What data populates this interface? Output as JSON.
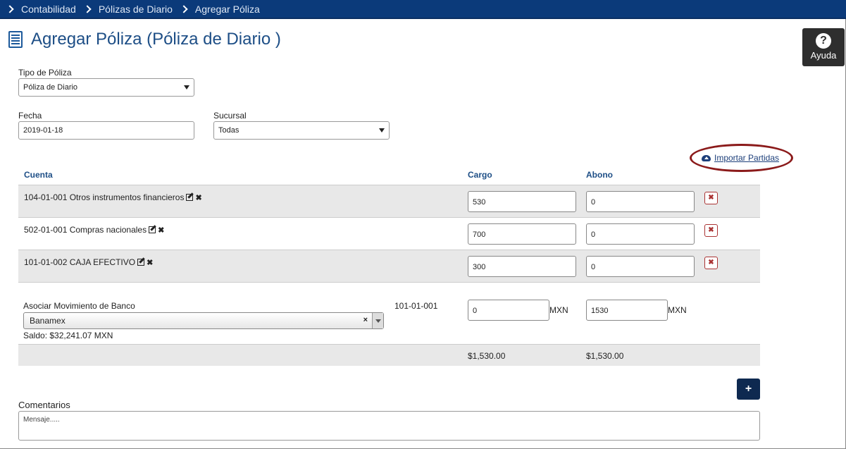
{
  "breadcrumb": [
    "Contabilidad",
    "Pólizas de Diario",
    "Agregar Póliza"
  ],
  "page_title": "Agregar Póliza (Póliza de Diario )",
  "help": {
    "label": "Ayuda",
    "glyph": "?"
  },
  "form": {
    "tipo_label": "Tipo de Póliza",
    "tipo_value": "Póliza de Diario",
    "fecha_label": "Fecha",
    "fecha_value": "2019-01-18",
    "sucursal_label": "Sucursal",
    "sucursal_value": "Todas"
  },
  "import_link": "Importar Partidas",
  "columns": {
    "cuenta": "Cuenta",
    "cargo": "Cargo",
    "abono": "Abono"
  },
  "rows": [
    {
      "account": "104-01-001 Otros instrumentos financieros",
      "cargo": "530",
      "abono": "0"
    },
    {
      "account": "502-01-001 Compras nacionales",
      "cargo": "700",
      "abono": "0"
    },
    {
      "account": "101-01-002 CAJA EFECTIVO",
      "cargo": "300",
      "abono": "0"
    }
  ],
  "bank": {
    "label": "Asociar Movimiento de Banco",
    "selected": "Banamex",
    "saldo": "Saldo: $32,241.07 MXN",
    "account": "101-01-001",
    "cargo": "0",
    "abono": "1530",
    "currency": "MXN"
  },
  "totals": {
    "cargo": "$1,530.00",
    "abono": "$1,530.00"
  },
  "add_button": "+",
  "comments": {
    "label": "Comentarios",
    "placeholder": "Mensaje....."
  },
  "colors": {
    "nav": "#0b3a7a",
    "title": "#1d4e86",
    "add_button": "#0e2950",
    "highlight": "#8b1a1a"
  }
}
